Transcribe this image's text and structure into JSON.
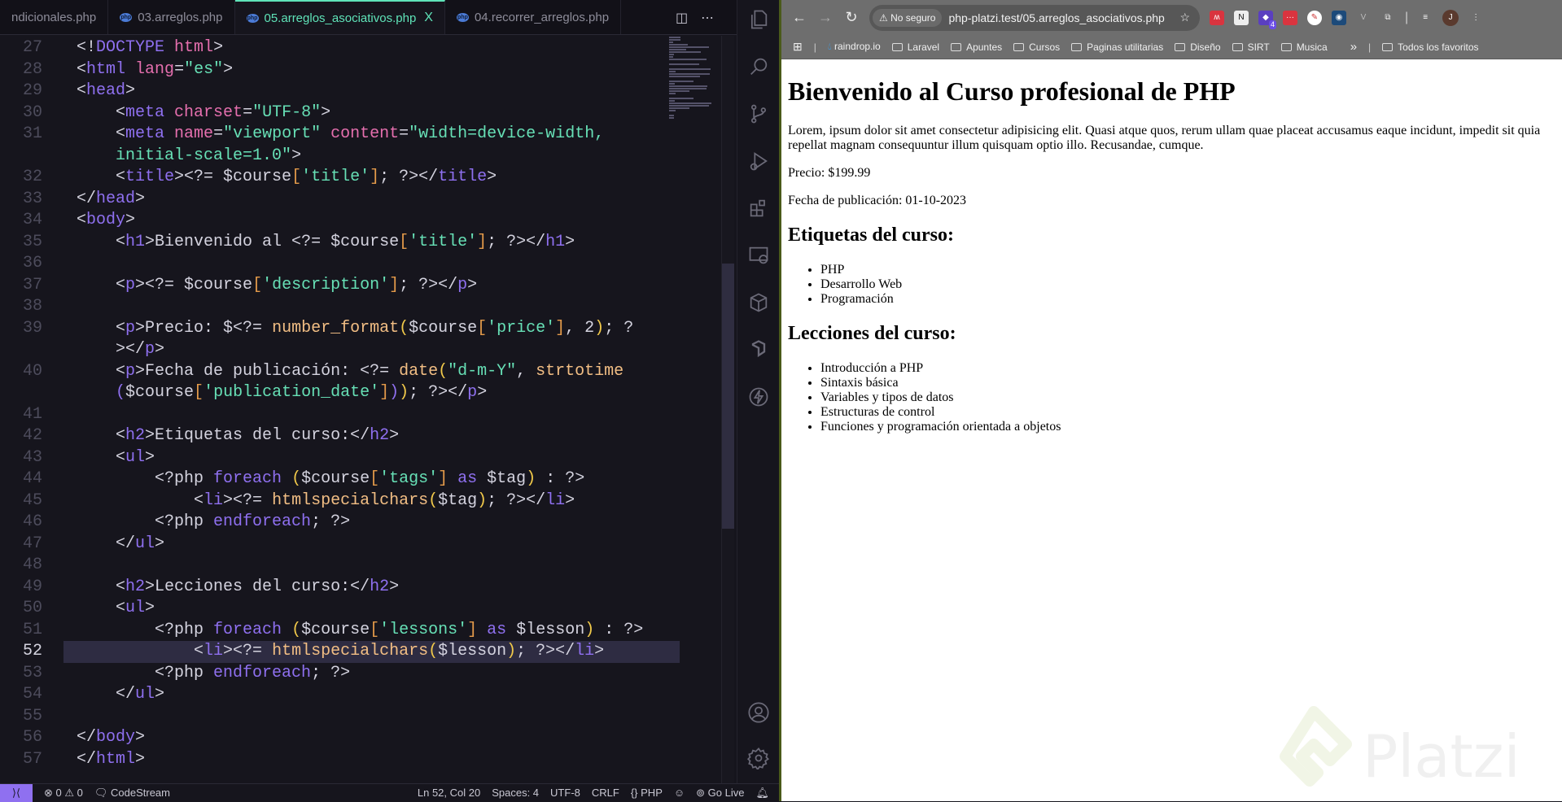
{
  "editor": {
    "tabs": [
      {
        "label": "ndicionales.php",
        "icon": "php-icon",
        "active": false
      },
      {
        "label": "03.arreglos.php",
        "icon": "php-icon",
        "active": false
      },
      {
        "label": "05.arreglos_asociativos.php",
        "icon": "php-icon",
        "active": true
      },
      {
        "label": "04.recorrer_arreglos.php",
        "icon": "php-icon",
        "active": false
      }
    ],
    "close_glyph": "X",
    "php_icon_text": "php",
    "current_line": "52",
    "lines": [
      {
        "n": "27",
        "tokens": [
          [
            "<!",
            ""
          ],
          [
            "DOCTYPE",
            "t"
          ],
          [
            " ",
            ""
          ],
          [
            "html",
            "a"
          ],
          [
            ">",
            ""
          ]
        ]
      },
      {
        "n": "28",
        "tokens": [
          [
            "<",
            ""
          ],
          [
            "html",
            "t"
          ],
          [
            " ",
            ""
          ],
          [
            "lang",
            "a"
          ],
          [
            "=",
            ""
          ],
          [
            "\"es\"",
            "s"
          ],
          [
            ">",
            ""
          ]
        ]
      },
      {
        "n": "29",
        "tokens": [
          [
            "<",
            ""
          ],
          [
            "head",
            "t"
          ],
          [
            ">",
            ""
          ]
        ]
      },
      {
        "n": "30",
        "tokens": [
          [
            "    <",
            ""
          ],
          [
            "meta",
            "t"
          ],
          [
            " ",
            ""
          ],
          [
            "charset",
            "a"
          ],
          [
            "=",
            ""
          ],
          [
            "\"UTF-8\"",
            "s"
          ],
          [
            ">",
            ""
          ]
        ]
      },
      {
        "n": "31",
        "tokens": [
          [
            "    <",
            ""
          ],
          [
            "meta",
            "t"
          ],
          [
            " ",
            ""
          ],
          [
            "name",
            "a"
          ],
          [
            "=",
            ""
          ],
          [
            "\"viewport\"",
            "s"
          ],
          [
            " ",
            ""
          ],
          [
            "content",
            "a"
          ],
          [
            "=",
            ""
          ],
          [
            "\"width=device-width,",
            "s"
          ]
        ]
      },
      {
        "n": "",
        "tokens": [
          [
            "    ",
            ""
          ],
          [
            "initial-scale=1.0\"",
            "s"
          ],
          [
            ">",
            ""
          ]
        ]
      },
      {
        "n": "32",
        "tokens": [
          [
            "    <",
            ""
          ],
          [
            "title",
            "t"
          ],
          [
            "><?= $course",
            ""
          ],
          [
            "[",
            "sq"
          ],
          [
            "'title'",
            "s"
          ],
          [
            "]",
            "sq"
          ],
          [
            "; ?></",
            ""
          ],
          [
            "title",
            "t"
          ],
          [
            ">",
            ""
          ]
        ]
      },
      {
        "n": "33",
        "tokens": [
          [
            "</",
            ""
          ],
          [
            "head",
            "t"
          ],
          [
            ">",
            ""
          ]
        ]
      },
      {
        "n": "34",
        "tokens": [
          [
            "<",
            ""
          ],
          [
            "body",
            "t"
          ],
          [
            ">",
            ""
          ]
        ]
      },
      {
        "n": "35",
        "tokens": [
          [
            "    <",
            ""
          ],
          [
            "h1",
            "t"
          ],
          [
            ">Bienvenido al <?= $course",
            ""
          ],
          [
            "[",
            "sq"
          ],
          [
            "'title'",
            "s"
          ],
          [
            "]",
            "sq"
          ],
          [
            "; ?></",
            ""
          ],
          [
            "h1",
            "t"
          ],
          [
            ">",
            ""
          ]
        ]
      },
      {
        "n": "36",
        "tokens": []
      },
      {
        "n": "37",
        "tokens": [
          [
            "    <",
            ""
          ],
          [
            "p",
            "t"
          ],
          [
            "><?= $course",
            ""
          ],
          [
            "[",
            "sq"
          ],
          [
            "'description'",
            "s"
          ],
          [
            "]",
            "sq"
          ],
          [
            "; ?></",
            ""
          ],
          [
            "p",
            "t"
          ],
          [
            ">",
            ""
          ]
        ]
      },
      {
        "n": "38",
        "tokens": []
      },
      {
        "n": "39",
        "tokens": [
          [
            "    <",
            ""
          ],
          [
            "p",
            "t"
          ],
          [
            ">Precio: $<?= ",
            ""
          ],
          [
            "number_format",
            "f"
          ],
          [
            "(",
            "b"
          ],
          [
            "$course",
            ""
          ],
          [
            "[",
            "sq"
          ],
          [
            "'price'",
            "s"
          ],
          [
            "]",
            "sq"
          ],
          [
            ", 2",
            ""
          ],
          [
            ")",
            "b"
          ],
          [
            "; ?",
            ""
          ]
        ]
      },
      {
        "n": "",
        "tokens": [
          [
            "    ></",
            ""
          ],
          [
            "p",
            "t"
          ],
          [
            ">",
            ""
          ]
        ]
      },
      {
        "n": "40",
        "tokens": [
          [
            "    <",
            ""
          ],
          [
            "p",
            "t"
          ],
          [
            ">Fecha de publicación: <?= ",
            ""
          ],
          [
            "date",
            "f"
          ],
          [
            "(",
            "b"
          ],
          [
            "\"d-m-Y\"",
            "s"
          ],
          [
            ", ",
            ""
          ],
          [
            "strtotime",
            "f"
          ]
        ]
      },
      {
        "n": "",
        "tokens": [
          [
            "    ",
            ""
          ],
          [
            "(",
            "k"
          ],
          [
            "$course",
            ""
          ],
          [
            "[",
            "sq"
          ],
          [
            "'publication_date'",
            "s"
          ],
          [
            "]",
            "sq"
          ],
          [
            ")",
            "k"
          ],
          [
            ")",
            "b"
          ],
          [
            "; ?></",
            ""
          ],
          [
            "p",
            "t"
          ],
          [
            ">",
            ""
          ]
        ]
      },
      {
        "n": "41",
        "tokens": []
      },
      {
        "n": "42",
        "tokens": [
          [
            "    <",
            ""
          ],
          [
            "h2",
            "t"
          ],
          [
            ">Etiquetas del curso:</",
            ""
          ],
          [
            "h2",
            "t"
          ],
          [
            ">",
            ""
          ]
        ]
      },
      {
        "n": "43",
        "tokens": [
          [
            "    <",
            ""
          ],
          [
            "ul",
            "t"
          ],
          [
            ">",
            ""
          ]
        ]
      },
      {
        "n": "44",
        "tokens": [
          [
            "        <?php ",
            ""
          ],
          [
            "foreach",
            "k"
          ],
          [
            " ",
            ""
          ],
          [
            "(",
            "b"
          ],
          [
            "$course",
            ""
          ],
          [
            "[",
            "sq"
          ],
          [
            "'tags'",
            "s"
          ],
          [
            "]",
            "sq"
          ],
          [
            " ",
            ""
          ],
          [
            "as",
            "k"
          ],
          [
            " $tag",
            ""
          ],
          [
            ")",
            "b"
          ],
          [
            " : ?>",
            ""
          ]
        ]
      },
      {
        "n": "45",
        "tokens": [
          [
            "            <",
            ""
          ],
          [
            "li",
            "t"
          ],
          [
            "><?= ",
            ""
          ],
          [
            "htmlspecialchars",
            "f"
          ],
          [
            "(",
            "b"
          ],
          [
            "$tag",
            ""
          ],
          [
            ")",
            "b"
          ],
          [
            "; ?></",
            ""
          ],
          [
            "li",
            "t"
          ],
          [
            ">",
            ""
          ]
        ]
      },
      {
        "n": "46",
        "tokens": [
          [
            "        <?php ",
            ""
          ],
          [
            "endforeach",
            "k"
          ],
          [
            "; ?>",
            ""
          ]
        ]
      },
      {
        "n": "47",
        "tokens": [
          [
            "    </",
            ""
          ],
          [
            "ul",
            "t"
          ],
          [
            ">",
            ""
          ]
        ]
      },
      {
        "n": "48",
        "tokens": []
      },
      {
        "n": "49",
        "tokens": [
          [
            "    <",
            ""
          ],
          [
            "h2",
            "t"
          ],
          [
            ">Lecciones del curso:</",
            ""
          ],
          [
            "h2",
            "t"
          ],
          [
            ">",
            ""
          ]
        ]
      },
      {
        "n": "50",
        "tokens": [
          [
            "    <",
            ""
          ],
          [
            "ul",
            "t"
          ],
          [
            ">",
            ""
          ]
        ]
      },
      {
        "n": "51",
        "tokens": [
          [
            "        <?php ",
            ""
          ],
          [
            "foreach",
            "k"
          ],
          [
            " ",
            ""
          ],
          [
            "(",
            "b"
          ],
          [
            "$course",
            ""
          ],
          [
            "[",
            "sq"
          ],
          [
            "'lessons'",
            "s"
          ],
          [
            "]",
            "sq"
          ],
          [
            " ",
            ""
          ],
          [
            "as",
            "k"
          ],
          [
            " $lesson",
            ""
          ],
          [
            ")",
            "b"
          ],
          [
            " : ?>",
            ""
          ]
        ]
      },
      {
        "n": "52",
        "tokens": [
          [
            "            <",
            ""
          ],
          [
            "li",
            "t"
          ],
          [
            "><?= ",
            ""
          ],
          [
            "htmlspecialchars",
            "f"
          ],
          [
            "(",
            "b"
          ],
          [
            "$lesson",
            ""
          ],
          [
            ")",
            "b"
          ],
          [
            "; ?></",
            ""
          ],
          [
            "li",
            "t"
          ],
          [
            ">",
            ""
          ]
        ]
      },
      {
        "n": "53",
        "tokens": [
          [
            "        <?php ",
            ""
          ],
          [
            "endforeach",
            "k"
          ],
          [
            "; ?>",
            ""
          ]
        ]
      },
      {
        "n": "54",
        "tokens": [
          [
            "    </",
            ""
          ],
          [
            "ul",
            "t"
          ],
          [
            ">",
            ""
          ]
        ]
      },
      {
        "n": "55",
        "tokens": []
      },
      {
        "n": "56",
        "tokens": [
          [
            "</",
            ""
          ],
          [
            "body",
            "t"
          ],
          [
            ">",
            ""
          ]
        ]
      },
      {
        "n": "57",
        "tokens": [
          [
            "</",
            ""
          ],
          [
            "html",
            "t"
          ],
          [
            ">",
            ""
          ]
        ]
      }
    ],
    "colors": {
      "background": "#16151d",
      "tag": "#8f70f0",
      "attribute": "#e56fae",
      "string": "#67e0b6",
      "function": "#f2be84",
      "accent": "#5fe3b8"
    }
  },
  "statusbar": {
    "errors": "0",
    "warnings": "0",
    "codestream": "CodeStream",
    "position": "Ln 52, Col 20",
    "spaces": "Spaces: 4",
    "encoding": "UTF-8",
    "eol": "CRLF",
    "language": "PHP",
    "golive": "Go Live"
  },
  "browser": {
    "security": "No seguro",
    "url": "php-platzi.test/05.arreglos_asociativos.php",
    "ext_badge": "4",
    "profile_initial": "J",
    "bookmarks": [
      "raindrop.io",
      "Laravel",
      "Apuntes",
      "Cursos",
      "Paginas utilitarias",
      "Diseño",
      "SIRT",
      "Musica"
    ],
    "more": "»",
    "all_bookmarks": "Todos los favoritos"
  },
  "page": {
    "h1": "Bienvenido al Curso profesional de PHP",
    "description": "Lorem, ipsum dolor sit amet consectetur adipisicing elit. Quasi atque quos, rerum ullam quae placeat accusamus eaque incidunt, impedit sit quia repellat magnam consequuntur illum quisquam optio illo. Recusandae, cumque.",
    "price": "Precio: $199.99",
    "date": "Fecha de publicación: 01-10-2023",
    "tags_title": "Etiquetas del curso:",
    "tags": [
      "PHP",
      "Desarrollo Web",
      "Programación"
    ],
    "lessons_title": "Lecciones del curso:",
    "lessons": [
      "Introducción a PHP",
      "Sintaxis básica",
      "Variables y tipos de datos",
      "Estructuras de control",
      "Funciones y programación orientada a objetos"
    ]
  },
  "watermark": "Platzi"
}
